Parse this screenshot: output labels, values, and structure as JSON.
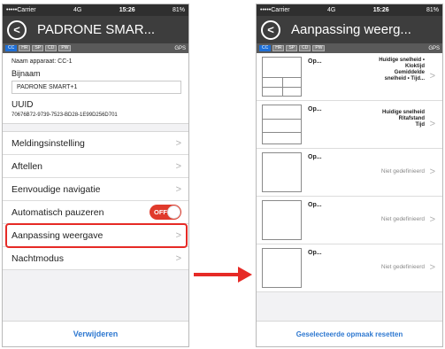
{
  "left": {
    "status": {
      "carrier": "•••••Carrier",
      "network": "4G",
      "time": "15:26",
      "battery": "81%"
    },
    "nav": {
      "back_glyph": "<",
      "title": "PADRONE SMAR..."
    },
    "sensors": [
      "CC",
      "HR",
      "SP",
      "CD",
      "PW"
    ],
    "gps": "GPS",
    "device_name": "Naam apparaat:  CC-1",
    "nickname_label": "Bijnaam",
    "nickname_value": "PADRONE SMART+1",
    "uuid_label": "UUID",
    "uuid_value": "70676B72-9739-7523-BD28-1E99D256D701",
    "menu": [
      {
        "label": "Meldingsinstelling",
        "chevron": ">"
      },
      {
        "label": "Aftellen",
        "chevron": ">"
      },
      {
        "label": "Eenvoudige navigatie",
        "chevron": ">"
      },
      {
        "label": "Automatisch pauzeren",
        "toggle": "OFF"
      },
      {
        "label": "Aanpassing weergave",
        "chevron": ">"
      },
      {
        "label": "Nachtmodus",
        "chevron": ">"
      }
    ],
    "delete_label": "Verwijderen"
  },
  "right": {
    "status": {
      "carrier": "•••••Carrier",
      "network": "4G",
      "time": "15:26",
      "battery": "81%"
    },
    "nav": {
      "back_glyph": "<",
      "title": "Aanpassing weerg..."
    },
    "sensors": [
      "CC",
      "HR",
      "SP",
      "CD",
      "PW"
    ],
    "gps": "GPS",
    "layouts": [
      {
        "label": "Op...",
        "lines": [
          "Huidige snelheid •",
          "Kloktijd",
          "Gemiddelde",
          "snelheid • Tijd..."
        ]
      },
      {
        "label": "Op...",
        "lines": [
          "Huidige snelheid",
          "Ritafstand",
          "Tijd"
        ]
      },
      {
        "label": "Op...",
        "lines": [
          "Niet gedefinieerd"
        ]
      },
      {
        "label": "Op...",
        "lines": [
          "Niet gedefinieerd"
        ]
      },
      {
        "label": "Op...",
        "lines": [
          "Niet gedefinieerd"
        ]
      }
    ],
    "row_chevron": ">",
    "reset_label": "Geselecteerde opmaak resetten"
  },
  "colors": {
    "accent_red": "#e62a26",
    "link_blue": "#2e78d0",
    "navbar": "#3d3d3d",
    "toggle_off": "#e03a2b"
  },
  "icons": {
    "back": "back-arrow-icon",
    "chevron": "chevron-right-icon",
    "transition_arrow": "arrow-right-icon"
  }
}
